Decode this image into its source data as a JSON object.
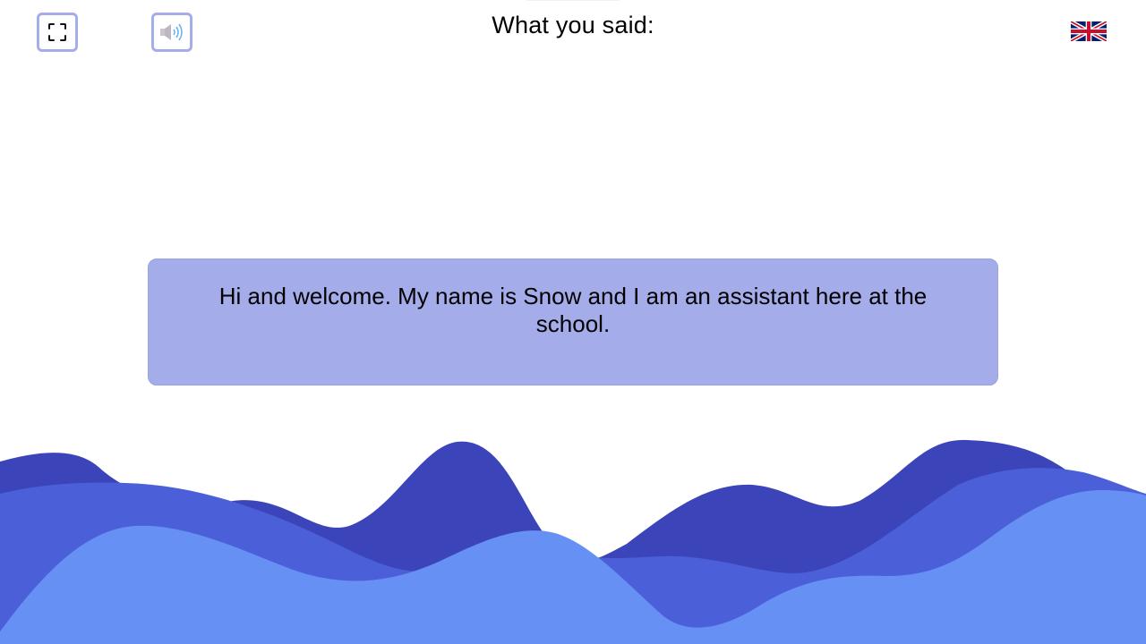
{
  "header": {
    "title": "What you said:"
  },
  "controls": {
    "fullscreen_icon": "fullscreen-icon",
    "speaker_icon": "speaker-icon",
    "language_flag": "uk-flag"
  },
  "message": {
    "text": "Hi and welcome. My name is Snow and I am an assistant here at the school."
  },
  "colors": {
    "button_border": "#a5acea",
    "message_bg": "#a5acea",
    "wave_dark": "#3b44b8",
    "wave_mid": "#4a5fd8",
    "wave_light": "#6690f4"
  }
}
